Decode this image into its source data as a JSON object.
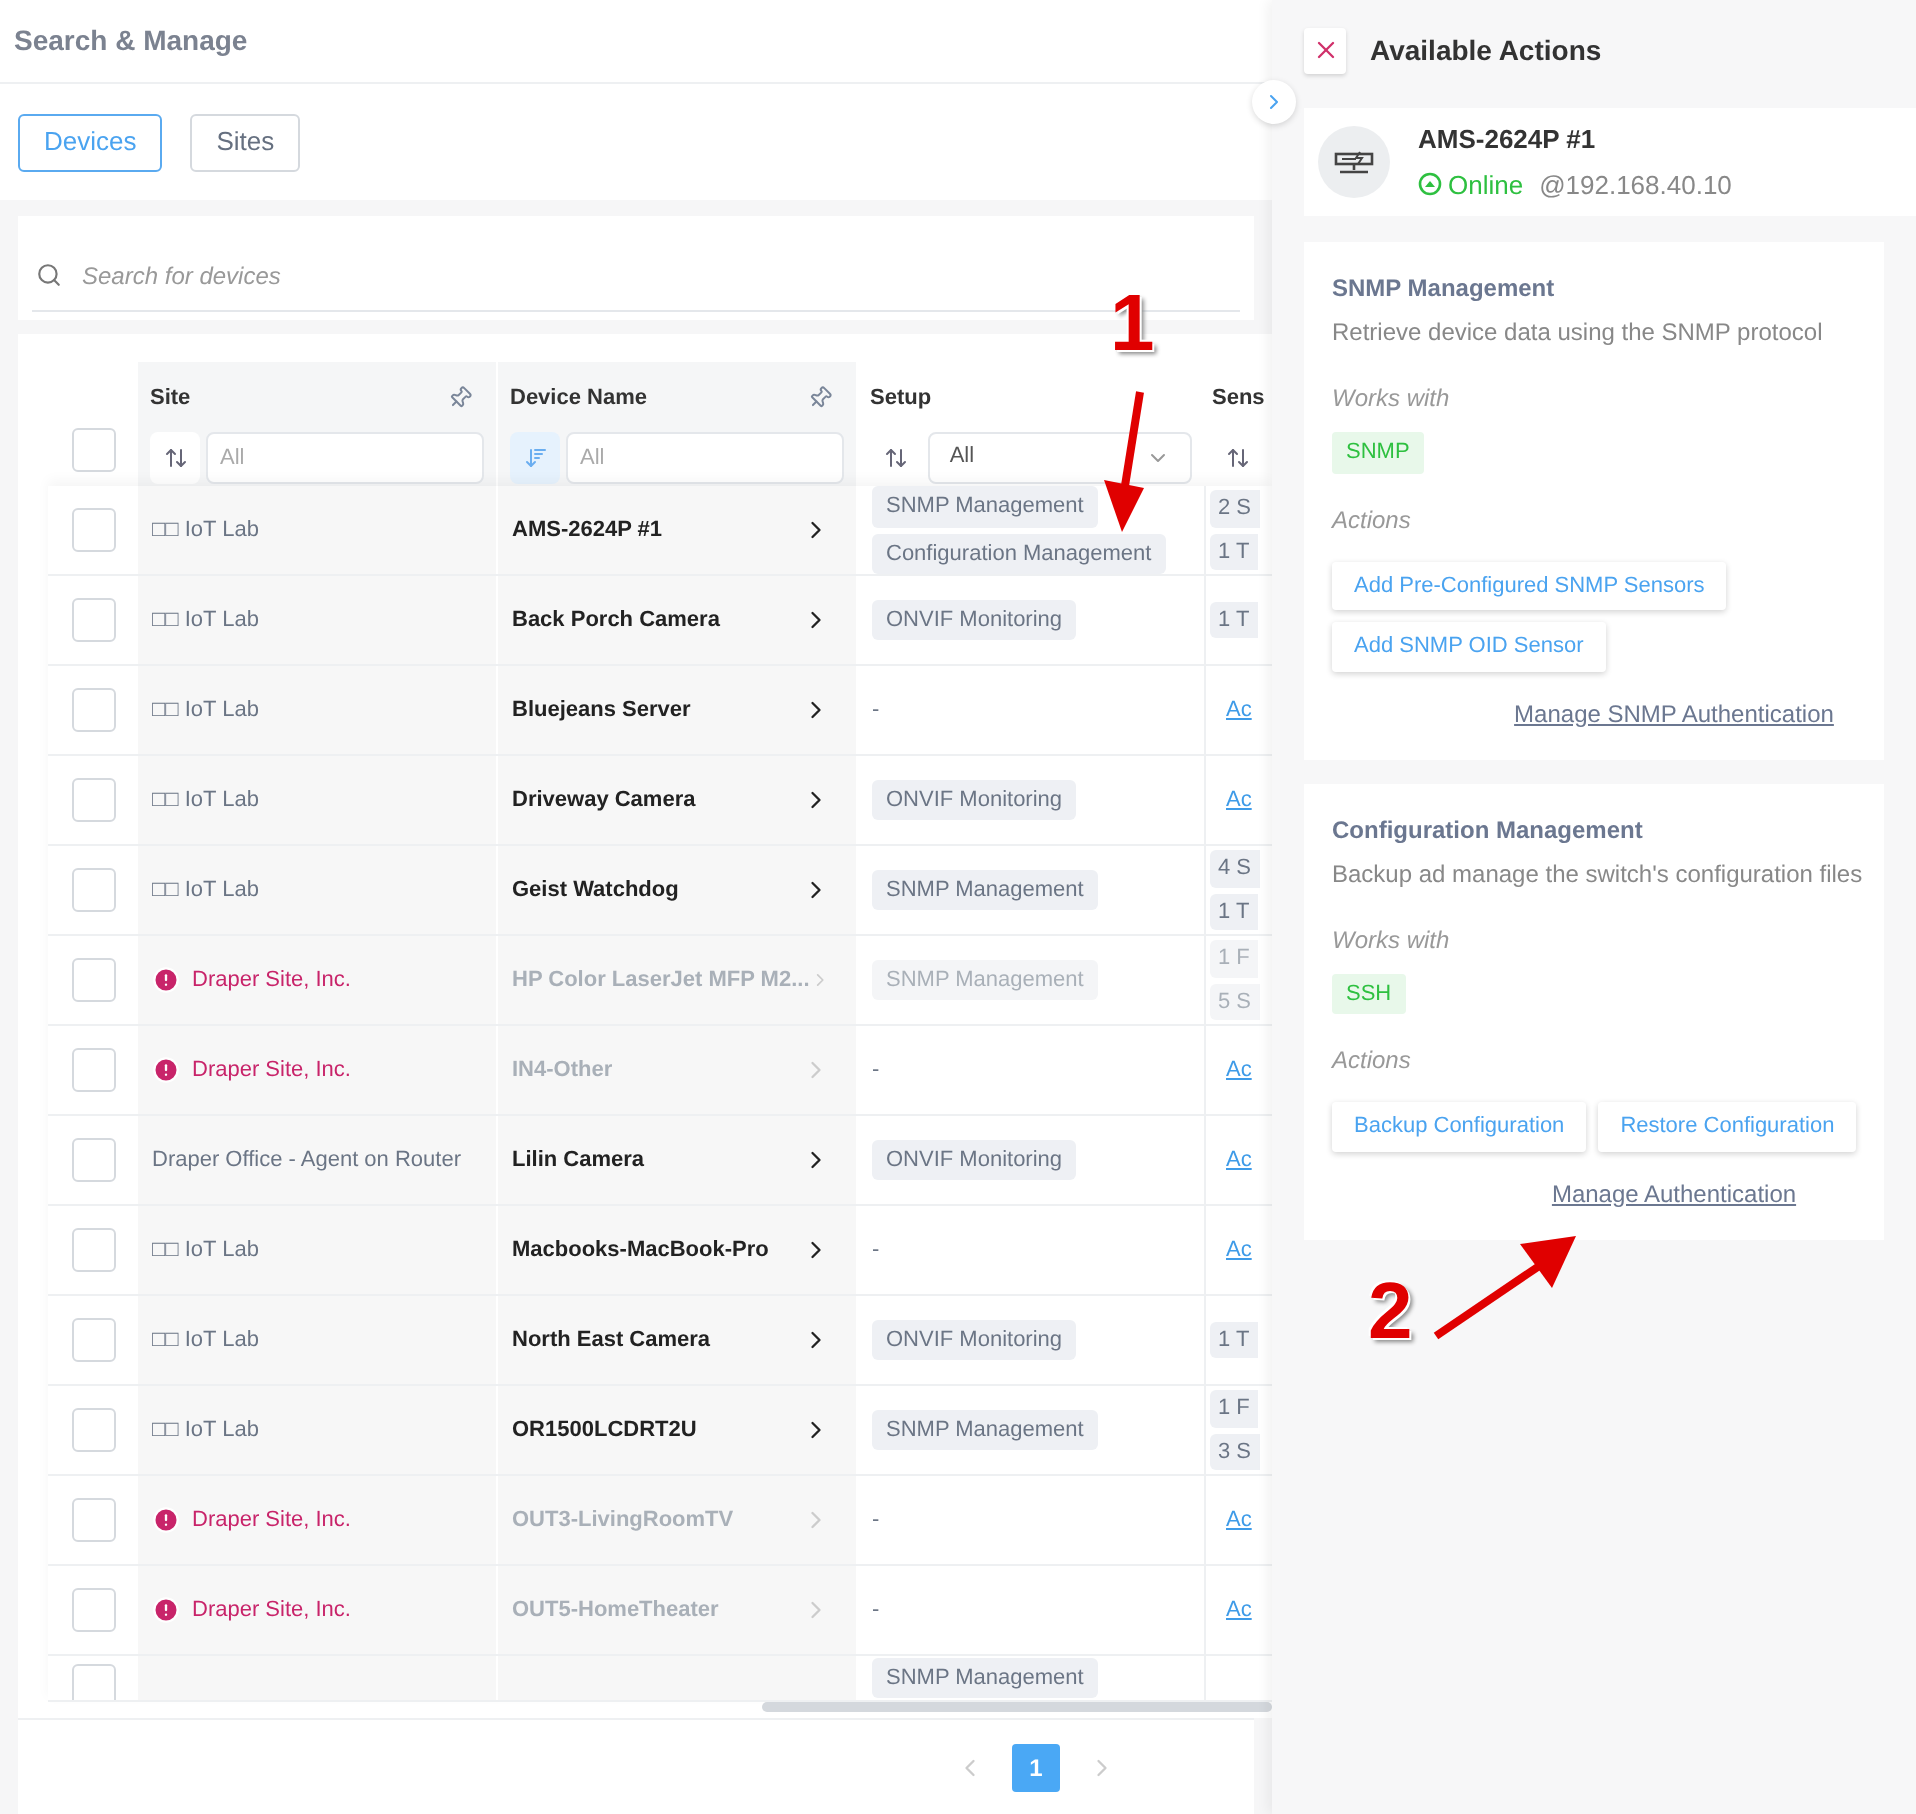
{
  "header": {
    "title": "Search & Manage"
  },
  "tabs": [
    {
      "label": "Devices",
      "selected": true
    },
    {
      "label": "Sites",
      "selected": false
    }
  ],
  "search": {
    "placeholder": "Search for devices"
  },
  "table": {
    "select_all": {
      "checked": false
    },
    "columns": [
      {
        "label": "Site",
        "pinned": true,
        "sorted": false,
        "kind": "text",
        "placeholder": "All"
      },
      {
        "label": "Device Name",
        "pinned": true,
        "sorted": true,
        "kind": "text",
        "placeholder": "All"
      },
      {
        "label": "Setup",
        "pinned": false,
        "sorted": false,
        "kind": "select",
        "filter": "All"
      },
      {
        "label": "Sens",
        "sorted": false,
        "kind": "none"
      }
    ],
    "rows": [
      {
        "checked": false,
        "site": "□□ IoT Lab",
        "alert": false,
        "device": "AMS-2624P #1",
        "disabled": false,
        "setup": [
          "SNMP Management",
          "Configuration Management"
        ],
        "sensors": [
          "2 S",
          "1 T"
        ]
      },
      {
        "checked": false,
        "site": "□□ IoT Lab",
        "alert": false,
        "device": "Back Porch Camera",
        "disabled": false,
        "setup": [
          "ONVIF Monitoring"
        ],
        "sensors": [
          "1 T"
        ]
      },
      {
        "checked": false,
        "site": "□□ IoT Lab",
        "alert": false,
        "device": "Bluejeans Server",
        "disabled": false,
        "setup_empty": "-",
        "sensors_link": "Ac"
      },
      {
        "checked": false,
        "site": "□□ IoT Lab",
        "alert": false,
        "device": "Driveway Camera",
        "disabled": false,
        "setup": [
          "ONVIF Monitoring"
        ],
        "sensors_link": "Ac"
      },
      {
        "checked": false,
        "site": "□□ IoT Lab",
        "alert": false,
        "device": "Geist Watchdog",
        "disabled": false,
        "setup": [
          "SNMP Management"
        ],
        "sensors": [
          "4 S",
          "1 T"
        ]
      },
      {
        "checked": false,
        "site": "Draper Site, Inc.",
        "alert": true,
        "device": "HP Color LaserJet MFP M2...",
        "disabled": true,
        "setup": [
          "SNMP Management"
        ],
        "sensors": [
          "1 F",
          "5 S"
        ]
      },
      {
        "checked": false,
        "site": "Draper Site, Inc.",
        "alert": true,
        "device": "IN4-Other",
        "disabled": true,
        "setup_empty": "-",
        "sensors_link": "Ac"
      },
      {
        "checked": false,
        "site": "Draper Office - Agent on Router",
        "alert": false,
        "device": "Lilin Camera",
        "disabled": false,
        "setup": [
          "ONVIF Monitoring"
        ],
        "sensors_link": "Ac"
      },
      {
        "checked": false,
        "site": "□□ IoT Lab",
        "alert": false,
        "device": "Macbooks-MacBook-Pro",
        "disabled": false,
        "setup_empty": "-",
        "sensors_link": "Ac"
      },
      {
        "checked": false,
        "site": "□□ IoT Lab",
        "alert": false,
        "device": "North East Camera",
        "disabled": false,
        "setup": [
          "ONVIF Monitoring"
        ],
        "sensors": [
          "1 T"
        ]
      },
      {
        "checked": false,
        "site": "□□ IoT Lab",
        "alert": false,
        "device": "OR1500LCDRT2U",
        "disabled": false,
        "setup": [
          "SNMP Management"
        ],
        "sensors": [
          "1 F",
          "3 S"
        ]
      },
      {
        "checked": false,
        "site": "Draper Site, Inc.",
        "alert": true,
        "device": "OUT3-LivingRoomTV",
        "disabled": true,
        "setup_empty": "-",
        "sensors_link": "Ac"
      },
      {
        "checked": false,
        "site": "Draper Site, Inc.",
        "alert": true,
        "device": "OUT5-HomeTheater",
        "disabled": true,
        "setup_empty": "-",
        "sensors_link": "Ac"
      },
      {
        "checked": false,
        "setup": [
          "SNMP Management"
        ]
      }
    ]
  },
  "pagination": {
    "pages": [
      {
        "label": "1",
        "selected": true
      }
    ]
  },
  "panel": {
    "title": "Available Actions",
    "device": {
      "name": "AMS-2624P #1",
      "status": "Online",
      "address": "@192.168.40.10"
    },
    "sections": [
      {
        "title": "SNMP Management",
        "description": "Retrieve device data using the SNMP protocol",
        "works_with_label": "Works with",
        "protocols": [
          "SNMP"
        ],
        "actions_label": "Actions",
        "actions": [
          "Add Pre-Configured SNMP Sensors",
          "Add SNMP OID Sensor"
        ],
        "actions_stacked": true,
        "link": "Manage SNMP Authentication"
      },
      {
        "title": "Configuration Management",
        "description": "Backup ad manage the switch's configuration files",
        "works_with_label": "Works with",
        "protocols": [
          "SSH"
        ],
        "actions_label": "Actions",
        "actions": [
          "Backup Configuration",
          "Restore Configuration"
        ],
        "actions_stacked": false,
        "link": "Manage Authentication"
      }
    ]
  },
  "annotations": [
    {
      "label": "1"
    },
    {
      "label": "2"
    }
  ]
}
